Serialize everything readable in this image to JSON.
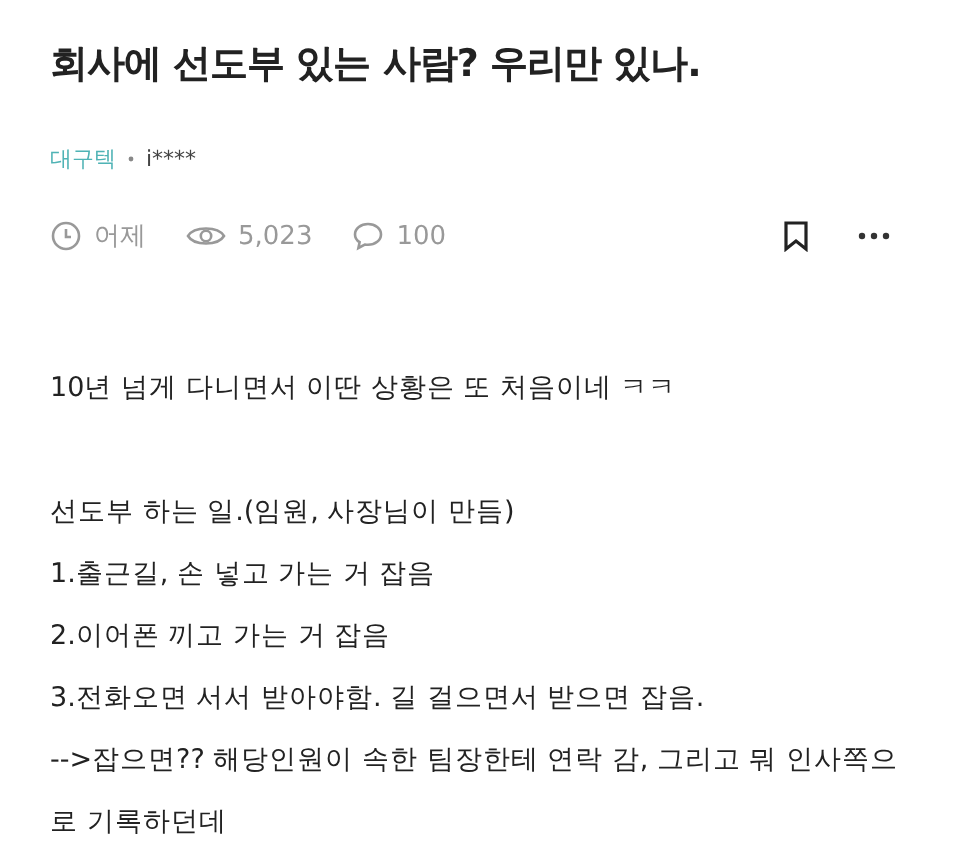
{
  "title": "회사에 선도부 있는 사람? 우리만 있나.",
  "meta": {
    "category": "대구텍",
    "author": "i****"
  },
  "stats": {
    "time": "어제",
    "views": "5,023",
    "comments": "100"
  },
  "body": [
    [
      "10년 넘게 다니면서 이딴 상황은 또 처음이네 ㅋㅋ"
    ],
    [
      "선도부 하는 일.(임원, 사장님이 만듬)",
      "1.출근길, 손 넣고 가는 거 잡음",
      "2.이어폰 끼고 가는 거 잡음",
      "3.전화오면 서서 받아야함. 길 걸으면서 받으면 잡음.",
      "-->잡으면?? 해당인원이 속한 팀장한테 연락 감, 그리고 뭐 인사쪽으로 기록하던데"
    ]
  ]
}
